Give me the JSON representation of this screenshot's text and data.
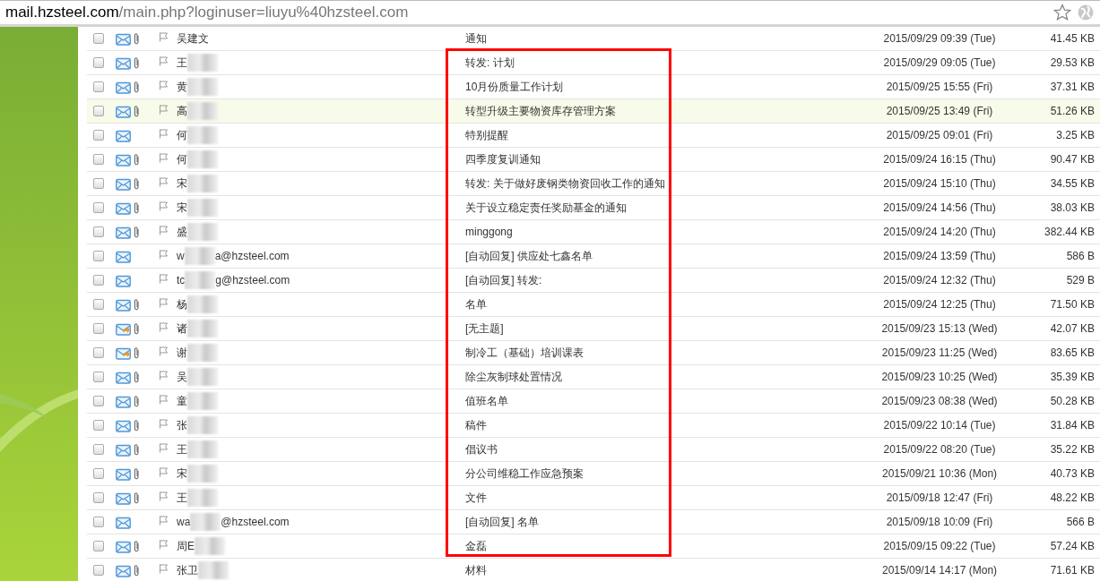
{
  "address_bar": {
    "host": "mail.hzsteel.com",
    "path": "/main.php?loginuser=liuyu%40hzsteel.com"
  },
  "annotation": {
    "kind": "outline",
    "color": "#ff0000"
  },
  "messages": [
    {
      "sender_start": "吴建文",
      "subject": "通知",
      "date": "2015/09/29 09:39 (Tue)",
      "size": "41.45 KB",
      "attachment": true,
      "replied": false,
      "highlighted": false,
      "redacted": false
    },
    {
      "sender_start": "王",
      "subject": "转发: 计划",
      "date": "2015/09/29 09:05 (Tue)",
      "size": "29.53 KB",
      "attachment": true,
      "replied": false,
      "highlighted": false,
      "redacted": true
    },
    {
      "sender_start": "黄",
      "subject": "10月份质量工作计划",
      "date": "2015/09/25 15:55 (Fri)",
      "size": "37.31 KB",
      "attachment": true,
      "replied": false,
      "highlighted": false,
      "redacted": true
    },
    {
      "sender_start": "高",
      "subject": "转型升级主要物资库存管理方案",
      "date": "2015/09/25 13:49 (Fri)",
      "size": "51.26 KB",
      "attachment": true,
      "replied": false,
      "highlighted": true,
      "redacted": true
    },
    {
      "sender_start": "何",
      "subject": "特别提醒",
      "date": "2015/09/25 09:01 (Fri)",
      "size": "3.25 KB",
      "attachment": false,
      "replied": false,
      "highlighted": false,
      "redacted": true
    },
    {
      "sender_start": "何",
      "subject": "四季度复训通知",
      "date": "2015/09/24 16:15 (Thu)",
      "size": "90.47 KB",
      "attachment": true,
      "replied": false,
      "highlighted": false,
      "redacted": true
    },
    {
      "sender_start": "宋",
      "subject": "转发: 关于做好废钢类物资回收工作的通知",
      "date": "2015/09/24 15:10 (Thu)",
      "size": "34.55 KB",
      "attachment": true,
      "replied": false,
      "highlighted": false,
      "redacted": true
    },
    {
      "sender_start": "宋",
      "subject": "关于设立稳定责任奖励基金的通知",
      "date": "2015/09/24 14:56 (Thu)",
      "size": "38.03 KB",
      "attachment": true,
      "replied": false,
      "highlighted": false,
      "redacted": true
    },
    {
      "sender_start": "盛",
      "subject": "minggong",
      "date": "2015/09/24 14:20 (Thu)",
      "size": "382.44 KB",
      "attachment": true,
      "replied": false,
      "highlighted": false,
      "redacted": true
    },
    {
      "sender_start": "w",
      "sender_end": "a@hzsteel.com",
      "subject": "[自动回复] 供应处七鑫名单",
      "date": "2015/09/24 13:59 (Thu)",
      "size": "586 B",
      "attachment": false,
      "replied": false,
      "highlighted": false,
      "redacted": true
    },
    {
      "sender_start": "tc",
      "sender_end": "g@hzsteel.com",
      "subject": "[自动回复] 转发:",
      "date": "2015/09/24 12:32 (Thu)",
      "size": "529 B",
      "attachment": false,
      "replied": false,
      "highlighted": false,
      "redacted": true
    },
    {
      "sender_start": "杨",
      "subject": "名单",
      "date": "2015/09/24 12:25 (Thu)",
      "size": "71.50 KB",
      "attachment": true,
      "replied": false,
      "highlighted": false,
      "redacted": true
    },
    {
      "sender_start": "诸",
      "subject": "[无主题]",
      "date": "2015/09/23 15:13 (Wed)",
      "size": "42.07 KB",
      "attachment": true,
      "replied": true,
      "highlighted": false,
      "redacted": true
    },
    {
      "sender_start": "谢",
      "subject": "制冷工（基础）培训课表",
      "date": "2015/09/23 11:25 (Wed)",
      "size": "83.65 KB",
      "attachment": true,
      "replied": true,
      "highlighted": false,
      "redacted": true
    },
    {
      "sender_start": "吴",
      "subject": "除尘灰制球处置情况",
      "date": "2015/09/23 10:25 (Wed)",
      "size": "35.39 KB",
      "attachment": true,
      "replied": false,
      "highlighted": false,
      "redacted": true
    },
    {
      "sender_start": "童",
      "subject": "值班名单",
      "date": "2015/09/23 08:38 (Wed)",
      "size": "50.28 KB",
      "attachment": true,
      "replied": false,
      "highlighted": false,
      "redacted": true
    },
    {
      "sender_start": "张",
      "subject": "稿件",
      "date": "2015/09/22 10:14 (Tue)",
      "size": "31.84 KB",
      "attachment": true,
      "replied": false,
      "highlighted": false,
      "redacted": true
    },
    {
      "sender_start": "王",
      "subject": "倡议书",
      "date": "2015/09/22 08:20 (Tue)",
      "size": "35.22 KB",
      "attachment": true,
      "replied": false,
      "highlighted": false,
      "redacted": true
    },
    {
      "sender_start": "宋",
      "subject": "分公司维稳工作应急预案",
      "date": "2015/09/21 10:36 (Mon)",
      "size": "40.73 KB",
      "attachment": true,
      "replied": false,
      "highlighted": false,
      "redacted": true
    },
    {
      "sender_start": "王",
      "subject": "文件",
      "date": "2015/09/18 12:47 (Fri)",
      "size": "48.22 KB",
      "attachment": true,
      "replied": false,
      "highlighted": false,
      "redacted": true
    },
    {
      "sender_start": "wa",
      "sender_end": "@hzsteel.com",
      "subject": "[自动回复] 名单",
      "date": "2015/09/18 10:09 (Fri)",
      "size": "566 B",
      "attachment": false,
      "replied": false,
      "highlighted": false,
      "redacted": true
    },
    {
      "sender_start": "周E",
      "subject": "金磊",
      "date": "2015/09/15 09:22 (Tue)",
      "size": "57.24 KB",
      "attachment": true,
      "replied": false,
      "highlighted": false,
      "redacted": true
    },
    {
      "sender_start": "张卫",
      "subject": "材料",
      "date": "2015/09/14 14:17 (Mon)",
      "size": "71.61 KB",
      "attachment": true,
      "replied": false,
      "highlighted": false,
      "redacted": true
    }
  ]
}
